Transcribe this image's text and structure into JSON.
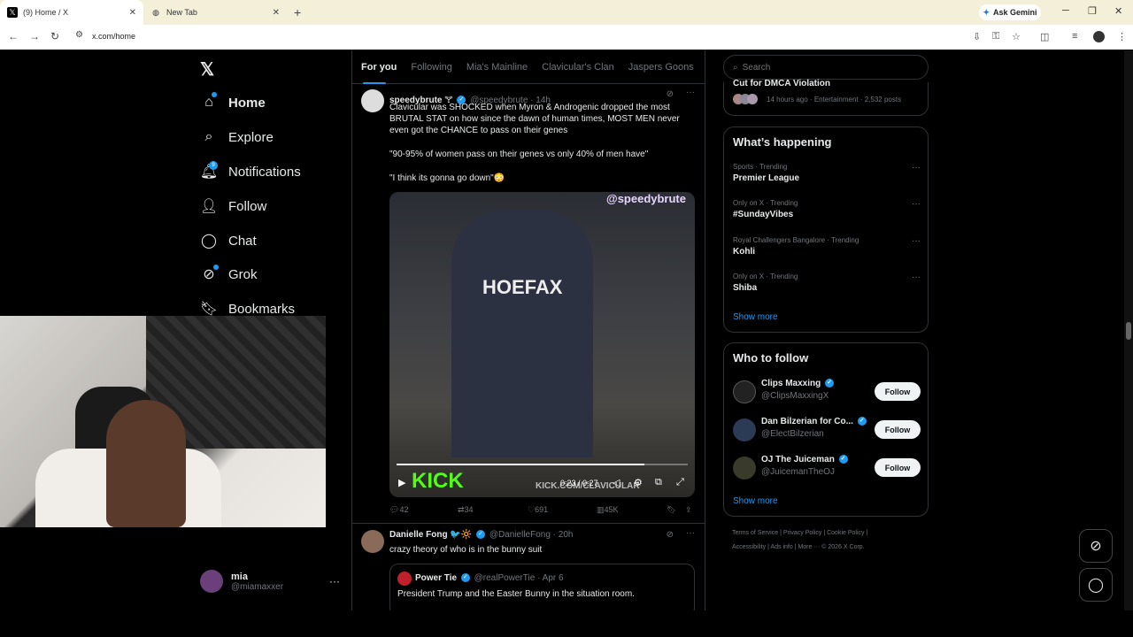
{
  "browser": {
    "tabs": [
      {
        "title": "(9) Home / X",
        "favicon": "x-logo-icon",
        "active": true
      },
      {
        "title": "New Tab",
        "favicon": "globe-icon",
        "active": false
      }
    ],
    "ask_label": "Ask Gemini",
    "url": "x.com/home"
  },
  "sidebar": {
    "logo": "𝕏",
    "items": [
      {
        "label": "Home",
        "icon": "home-icon"
      },
      {
        "label": "Explore",
        "icon": "search-icon"
      },
      {
        "label": "Notifications",
        "icon": "bell-icon",
        "badge": "9"
      },
      {
        "label": "Follow",
        "icon": "person-plus-icon"
      },
      {
        "label": "Chat",
        "icon": "chat-icon"
      },
      {
        "label": "Grok",
        "icon": "grok-icon"
      },
      {
        "label": "Bookmarks",
        "icon": "bookmark-icon"
      }
    ],
    "user": {
      "name": "mia",
      "handle": "@miamaxxer",
      "more": "···"
    }
  },
  "feed": {
    "tabs": [
      "For you",
      "Following",
      "Mia's Mainline",
      "Clavicular's Clan",
      "Jaspers Goons"
    ],
    "post1": {
      "name": "speedybrute",
      "name_suffix": "🝖",
      "handle": "@speedybrute · 14h",
      "text1": "Clavicular was SHOCKED when Myron & Androgenic dropped the most BRUTAL STAT on how since the dawn of human times, MOST MEN never even got the CHANCE to pass on their genes",
      "text2": "\"90-95% of women pass on their genes vs only 40% of men have\"",
      "text3": "\"I think its gonna go down\"😳",
      "video": {
        "watermark": "@speedybrute",
        "brand": "HOEFAX",
        "kick": "KICK",
        "kick_url": "KICK.COM/CLAVICULAR",
        "time": "0:23 / 0:27",
        "progress": 0.85
      },
      "replies": "42",
      "reposts": "34",
      "likes": "691",
      "views": "45K"
    },
    "post2": {
      "name": "Danielle Fong",
      "name_suffix": "🐦🔆",
      "handle": "@DanielleFong · 20h",
      "text": "crazy theory of who is in the bunny suit",
      "quote": {
        "name": "Power Tie",
        "handle": "@realPowerTie · Apr 6",
        "text": "President Trump and the Easter Bunny in the situation room."
      }
    }
  },
  "right": {
    "search_placeholder": "Search",
    "top_card": {
      "title": "Cut for DMCA Violation",
      "meta": "14 hours ago · Entertainment · 2,532 posts"
    },
    "happening": {
      "title": "What’s happening",
      "trends": [
        {
          "context": "Sports · Trending",
          "topic": "Premier League"
        },
        {
          "context": "Only on X · Trending",
          "topic": "#SundayVibes"
        },
        {
          "context": "Royal Challengers Bangalore · Trending",
          "topic": "Kohli"
        },
        {
          "context": "Only on X · Trending",
          "topic": "Shiba"
        }
      ],
      "show_more": "Show more"
    },
    "who_to_follow": {
      "title": "Who to follow",
      "accounts": [
        {
          "name": "Clips Maxxing",
          "handle": "@ClipsMaxxingX",
          "button": "Follow"
        },
        {
          "name": "Dan Bilzerian for Co...",
          "handle": "@ElectBilzerian",
          "button": "Follow"
        },
        {
          "name": "OJ The Juiceman",
          "handle": "@JuicemanTheOJ",
          "button": "Follow"
        }
      ],
      "show_more": "Show more"
    },
    "footer": {
      "line1": "Terms of Service  |  Privacy Policy  |  Cookie Policy  |",
      "line2": "Accessibility  |  Ads info  |  More ···  © 2026 X Corp."
    }
  }
}
